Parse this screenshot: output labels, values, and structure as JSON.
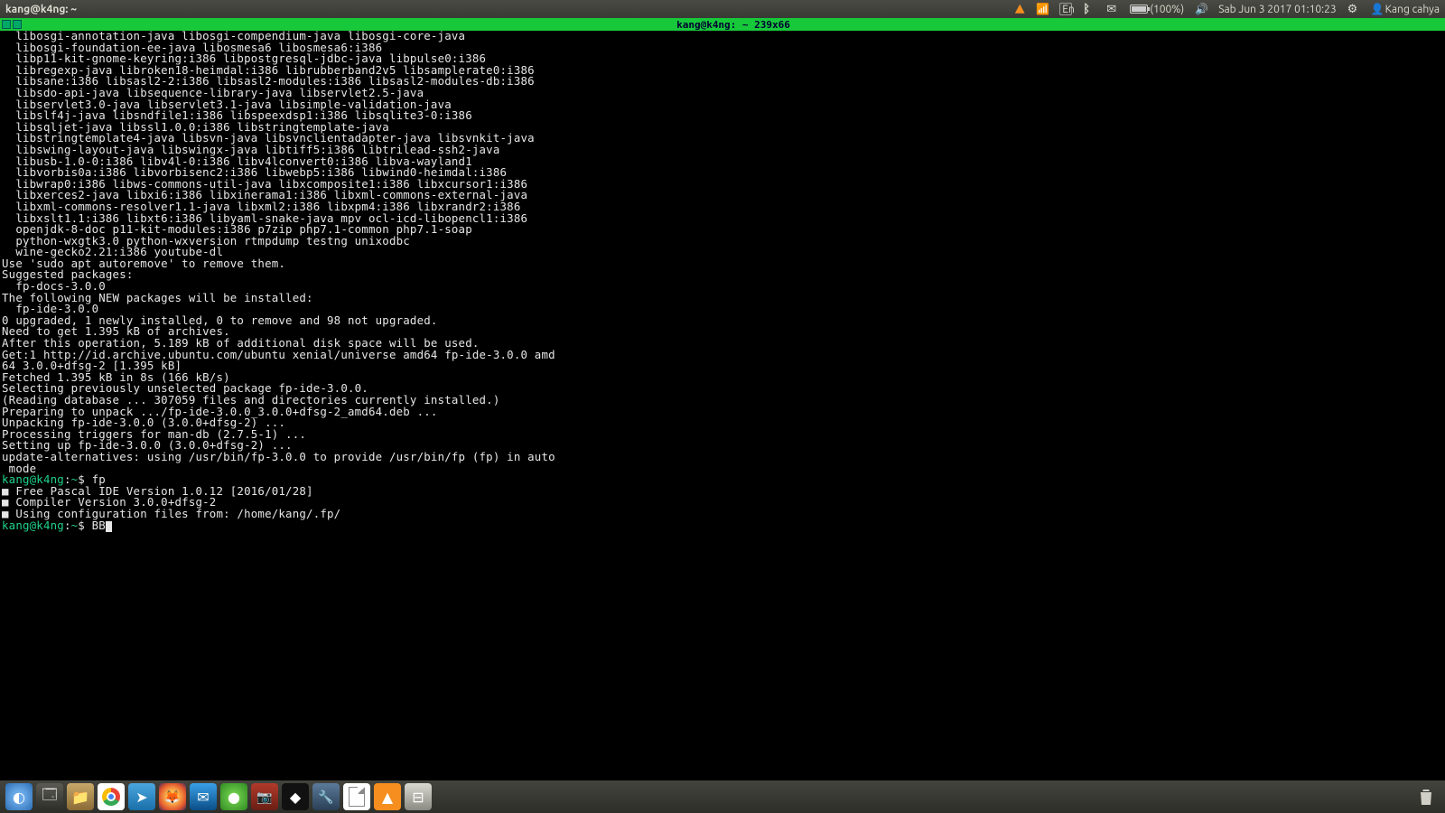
{
  "topbar": {
    "title": "kang@k4ng: ~",
    "lang": "En",
    "battery": "(100%)",
    "clock": "Sab Jun  3 2017 01:10:23",
    "user": "Kang cahya"
  },
  "termbar": {
    "title": "kang@k4ng: ~  239x66"
  },
  "term_lines": [
    "  libosgi-annotation-java libosgi-compendium-java libosgi-core-java",
    "  libosgi-foundation-ee-java libosmesa6 libosmesa6:i386",
    "  libp11-kit-gnome-keyring:i386 libpostgresql-jdbc-java libpulse0:i386",
    "  libregexp-java libroken18-heimdal:i386 librubberband2v5 libsamplerate0:i386",
    "  libsane:i386 libsasl2-2:i386 libsasl2-modules:i386 libsasl2-modules-db:i386",
    "  libsdo-api-java libsequence-library-java libservlet2.5-java",
    "  libservlet3.0-java libservlet3.1-java libsimple-validation-java",
    "  libslf4j-java libsndfile1:i386 libspeexdsp1:i386 libsqlite3-0:i386",
    "  libsqljet-java libssl1.0.0:i386 libstringtemplate-java",
    "  libstringtemplate4-java libsvn-java libsvnclientadapter-java libsvnkit-java",
    "  libswing-layout-java libswingx-java libtiff5:i386 libtrilead-ssh2-java",
    "  libusb-1.0-0:i386 libv4l-0:i386 libv4lconvert0:i386 libva-wayland1",
    "  libvorbis0a:i386 libvorbisenc2:i386 libwebp5:i386 libwind0-heimdal:i386",
    "  libwrap0:i386 libws-commons-util-java libxcomposite1:i386 libxcursor1:i386",
    "  libxerces2-java libxi6:i386 libxinerama1:i386 libxml-commons-external-java",
    "  libxml-commons-resolver1.1-java libxml2:i386 libxpm4:i386 libxrandr2:i386",
    "  libxslt1.1:i386 libxt6:i386 libyaml-snake-java mpv ocl-icd-libopencl1:i386",
    "  openjdk-8-doc p11-kit-modules:i386 p7zip php7.1-common php7.1-soap",
    "  python-wxgtk3.0 python-wxversion rtmpdump testng unixodbc",
    "  wine-gecko2.21:i386 youtube-dl",
    "Use 'sudo apt autoremove' to remove them.",
    "Suggested packages:",
    "  fp-docs-3.0.0",
    "The following NEW packages will be installed:",
    "  fp-ide-3.0.0",
    "0 upgraded, 1 newly installed, 0 to remove and 98 not upgraded.",
    "Need to get 1.395 kB of archives.",
    "After this operation, 5.189 kB of additional disk space will be used.",
    "Get:1 http://id.archive.ubuntu.com/ubuntu xenial/universe amd64 fp-ide-3.0.0 amd",
    "64 3.0.0+dfsg-2 [1.395 kB]",
    "Fetched 1.395 kB in 8s (166 kB/s)",
    "Selecting previously unselected package fp-ide-3.0.0.",
    "(Reading database ... 307059 files and directories currently installed.)",
    "Preparing to unpack .../fp-ide-3.0.0_3.0.0+dfsg-2_amd64.deb ...",
    "Unpacking fp-ide-3.0.0 (3.0.0+dfsg-2) ...",
    "Processing triggers for man-db (2.7.5-1) ...",
    "Setting up fp-ide-3.0.0 (3.0.0+dfsg-2) ...",
    "update-alternatives: using /usr/bin/fp-3.0.0 to provide /usr/bin/fp (fp) in auto",
    " mode"
  ],
  "prompt1": {
    "user": "kang@k4ng",
    "path": "~",
    "cmd": "fp"
  },
  "fp_out": [
    "■ Free Pascal IDE Version 1.0.12 [2016/01/28]",
    "■ Compiler Version 3.0.0+dfsg-2",
    "■ Using configuration files from: /home/kang/.fp/"
  ],
  "prompt2": {
    "user": "kang@k4ng",
    "path": "~",
    "cmd": "BB"
  },
  "dock": {
    "apps": [
      {
        "n": "show-apps",
        "cls": "menu"
      },
      {
        "n": "file-manager",
        "cls": "files"
      },
      {
        "n": "files-folder",
        "cls": "folder"
      },
      {
        "n": "chrome",
        "cls": "chrome"
      },
      {
        "n": "telegram",
        "cls": "telegram"
      },
      {
        "n": "firefox",
        "cls": "firefox"
      },
      {
        "n": "thunderbird",
        "cls": "thunderbird"
      },
      {
        "n": "browser-green",
        "cls": "midori"
      },
      {
        "n": "screenshot",
        "cls": "pics"
      },
      {
        "n": "inkscape",
        "cls": "ink"
      },
      {
        "n": "system-tools",
        "cls": "tools"
      },
      {
        "n": "libreoffice",
        "cls": "libre"
      },
      {
        "n": "vlc",
        "cls": "vlc2"
      },
      {
        "n": "disks",
        "cls": "disk"
      }
    ]
  }
}
